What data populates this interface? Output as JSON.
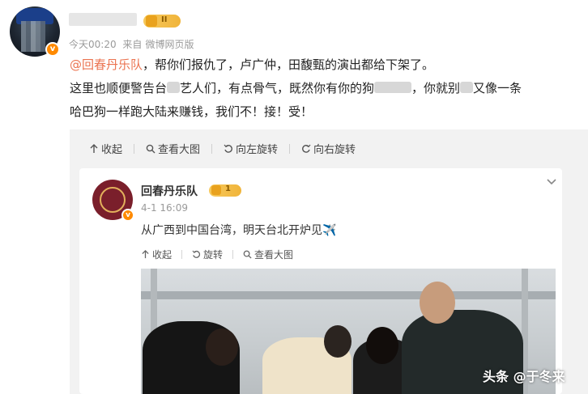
{
  "post": {
    "level": "II",
    "time": "今天00:20",
    "source_prefix": "来自",
    "source": "微博网页版",
    "mention": "@回春丹乐队",
    "line1_rest": "，帮你们报仇了，卢广仲，田馥甄的演出都给下架了。",
    "line2_a": "这里也顺便警告台",
    "line2_b": "艺人们，有点骨气，既然你有你的狗",
    "line2_c": "，你就别",
    "line2_d": "又像一条",
    "line3": "哈巴狗一样跑大陆来赚钱，我们不！接！受！"
  },
  "toolbar": {
    "collapse": "收起",
    "view_large": "查看大图",
    "rotate_left": "向左旋转",
    "rotate_right": "向右旋转"
  },
  "repost": {
    "author": "回春丹乐队",
    "level": "1",
    "time": "4-1 16:09",
    "text": "从广西到中国台湾，明天台北开炉见✈️",
    "actions": {
      "collapse": "收起",
      "rotate": "旋转",
      "view_large": "查看大图"
    }
  },
  "watermark": "头条 @于冬来"
}
